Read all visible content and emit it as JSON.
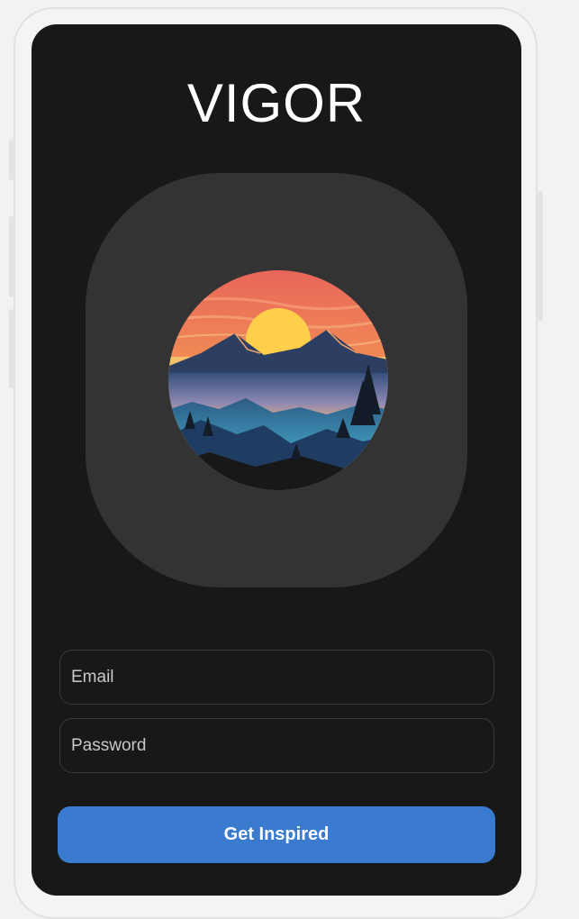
{
  "app": {
    "title": "VIGOR"
  },
  "logo": {
    "icon": "mountain-sunset-logo"
  },
  "form": {
    "email_placeholder": "Email",
    "password_placeholder": "Password",
    "submit_label": "Get Inspired"
  },
  "colors": {
    "screen_background": "#181818",
    "card_background": "#333333",
    "button_accent": "#3a7bcf",
    "text": "#ffffff"
  }
}
